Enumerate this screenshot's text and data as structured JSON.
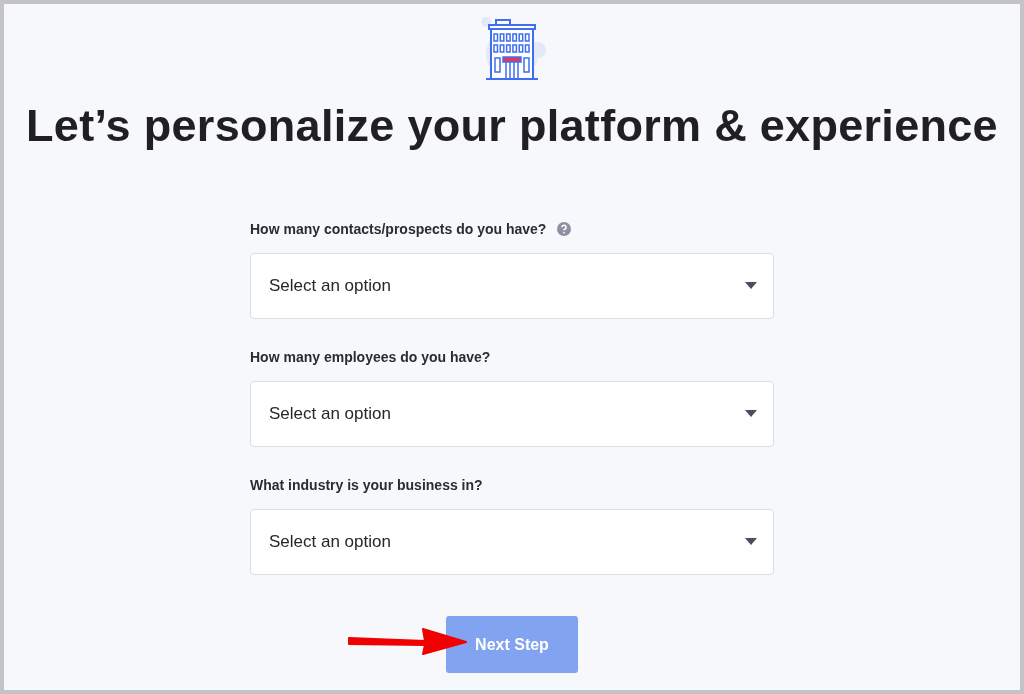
{
  "heading": "Let’s personalize your platform & experience",
  "questions": [
    {
      "label": "How many contacts/prospects do you have?",
      "help": true,
      "value": "Select an option"
    },
    {
      "label": "How many employees do you have?",
      "help": false,
      "value": "Select an option"
    },
    {
      "label": "What industry is your business in?",
      "help": false,
      "value": "Select an option"
    }
  ],
  "next_button": {
    "label": "Next Step",
    "disabled": true
  }
}
